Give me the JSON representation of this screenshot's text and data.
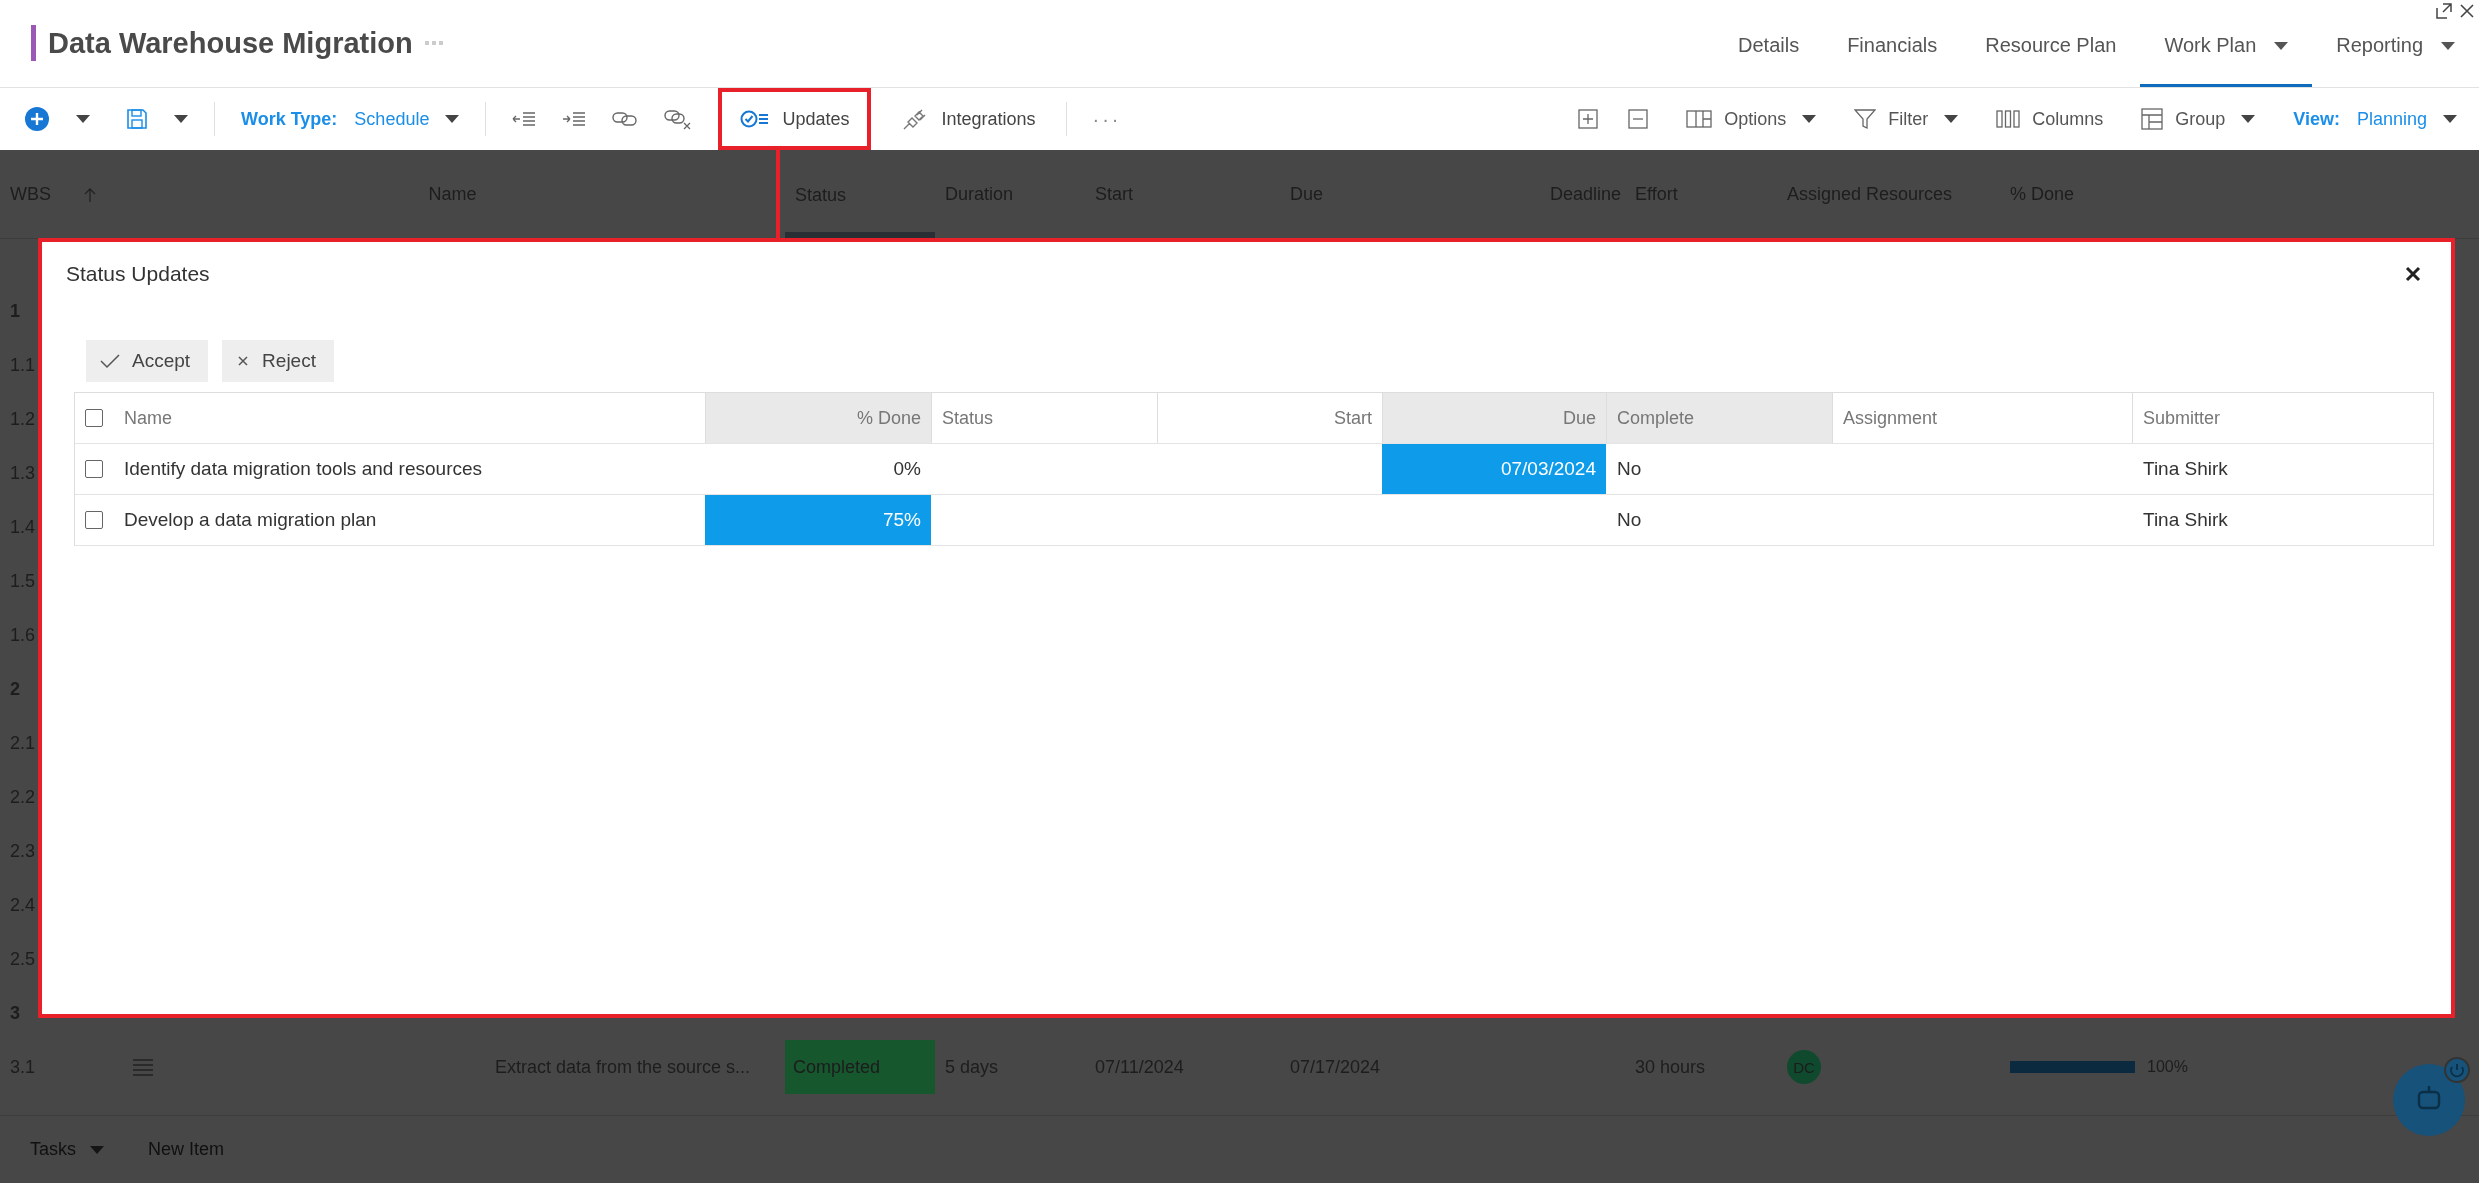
{
  "window": {
    "title": "Data Warehouse Migration"
  },
  "nav_tabs": [
    {
      "label": "Details",
      "selected": false,
      "has_menu": false
    },
    {
      "label": "Financials",
      "selected": false,
      "has_menu": false
    },
    {
      "label": "Resource Plan",
      "selected": false,
      "has_menu": false
    },
    {
      "label": "Work Plan",
      "selected": true,
      "has_menu": true
    },
    {
      "label": "Reporting",
      "selected": false,
      "has_menu": true
    }
  ],
  "toolbar": {
    "work_type": {
      "label": "Work Type:",
      "value": "Schedule"
    },
    "updates": {
      "label": "Updates",
      "highlighted": true
    },
    "integrations": "Integrations",
    "more": "···",
    "options": "Options",
    "filter": "Filter",
    "columns": "Columns",
    "group": "Group",
    "view": {
      "label": "View:",
      "value": "Planning"
    }
  },
  "grid": {
    "columns": [
      "WBS",
      "Name",
      "Status",
      "Duration",
      "Start",
      "Due",
      "Deadline",
      "Effort",
      "Assigned Resources",
      "% Done"
    ],
    "rows": [
      {
        "wbs": "1",
        "summary": true
      },
      {
        "wbs": "1.1",
        "summary": false
      },
      {
        "wbs": "1.2",
        "summary": false
      },
      {
        "wbs": "1.3",
        "summary": false
      },
      {
        "wbs": "1.4",
        "summary": false
      },
      {
        "wbs": "1.5",
        "summary": false
      },
      {
        "wbs": "1.6",
        "summary": false
      },
      {
        "wbs": "2",
        "summary": true
      },
      {
        "wbs": "2.1",
        "summary": false
      },
      {
        "wbs": "2.2",
        "summary": false
      },
      {
        "wbs": "2.3",
        "summary": false
      },
      {
        "wbs": "2.4",
        "summary": false
      },
      {
        "wbs": "2.5",
        "summary": false
      },
      {
        "wbs": "3",
        "summary": true
      },
      {
        "wbs": "3.1",
        "summary": false,
        "name": "Extract data from the source s...",
        "status": "Completed",
        "duration": "5 days",
        "start": "07/11/2024",
        "due": "07/17/2024",
        "effort": "30 hours",
        "resource": "DC",
        "level": 1,
        "percent": "100%"
      }
    ]
  },
  "dialog": {
    "title": "Status Updates",
    "actions": [
      "Accept",
      "Reject"
    ],
    "all_checked": false,
    "columns": [
      {
        "label": "Name",
        "shaded": false
      },
      {
        "label": "% Done",
        "shaded": true
      },
      {
        "label": "Status",
        "shaded": false
      },
      {
        "label": "Start",
        "shaded": false
      },
      {
        "label": "Due",
        "shaded": true
      },
      {
        "label": "Complete",
        "shaded": true
      },
      {
        "label": "Assignment",
        "shaded": false
      },
      {
        "label": "Submitter",
        "shaded": false
      }
    ],
    "rows": [
      {
        "checked": false,
        "cells": [
          {
            "text": "Identify data migration tools and resources",
            "changed": false
          },
          {
            "text": "0%",
            "changed": false
          },
          {
            "changed": false
          },
          {
            "changed": false
          },
          {
            "text": "07/03/2024",
            "changed": true
          },
          {
            "text": "No",
            "changed": false
          },
          {
            "changed": false
          },
          {
            "text": "Tina Shirk",
            "changed": false
          }
        ]
      },
      {
        "checked": false,
        "cells": [
          {
            "text": "Develop a data migration plan",
            "changed": false
          },
          {
            "text": "75%",
            "changed": true
          },
          {
            "changed": false
          },
          {
            "changed": false
          },
          {
            "changed": false
          },
          {
            "text": "No",
            "changed": false
          },
          {
            "changed": false
          },
          {
            "text": "Tina Shirk",
            "changed": false
          }
        ]
      }
    ]
  },
  "footer": {
    "tab": "Tasks",
    "new_item": "New Item"
  }
}
